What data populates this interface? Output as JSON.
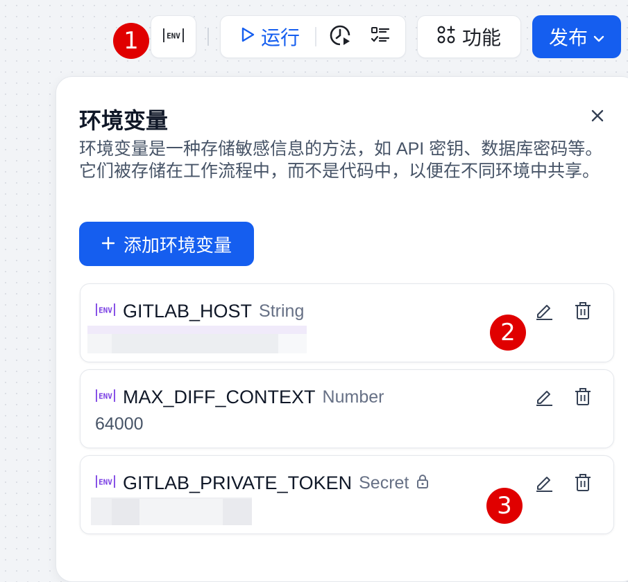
{
  "annotations": {
    "badge1": "1",
    "badge2": "2",
    "badge3": "3"
  },
  "toolbar": {
    "env_icon": "env-icon",
    "run_label": "运行",
    "feature_label": "功能",
    "publish_label": "发布"
  },
  "panel": {
    "title": "环境变量",
    "description": "环境变量是一种存储敏感信息的方法，如 API 密钥、数据库密码等。它们被存储在工作流程中，而不是代码中，以便在不同环境中共享。",
    "add_button_label": "添加环境变量"
  },
  "variables": [
    {
      "name": "GITLAB_HOST",
      "type": "String",
      "value": "",
      "value_redacted": true,
      "locked": false
    },
    {
      "name": "MAX_DIFF_CONTEXT",
      "type": "Number",
      "value": "64000",
      "value_redacted": false,
      "locked": false
    },
    {
      "name": "GITLAB_PRIVATE_TOKEN",
      "type": "Secret",
      "value": "",
      "value_redacted": true,
      "locked": true
    }
  ],
  "colors": {
    "accent": "#155eef",
    "badge": "#e00000",
    "env_icon": "#7a3fe4",
    "text_secondary": "#667085"
  }
}
